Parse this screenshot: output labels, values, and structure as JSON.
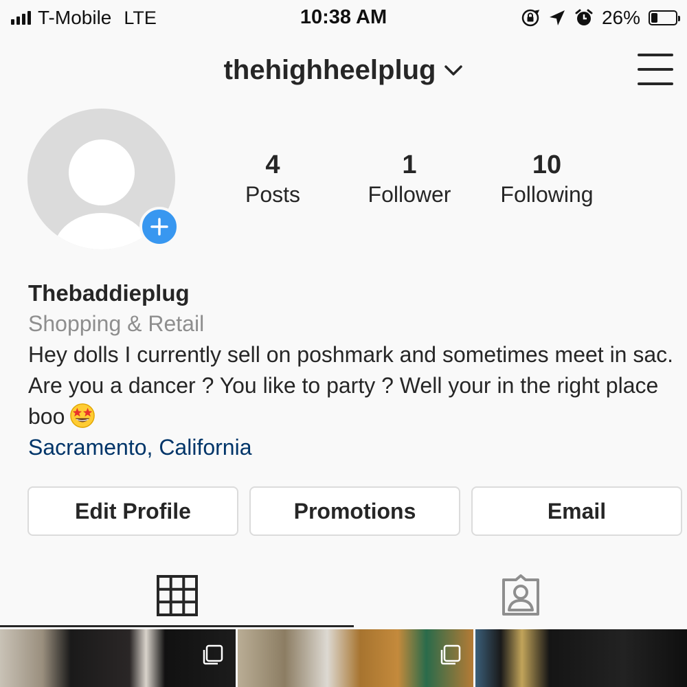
{
  "status_bar": {
    "carrier": "T-Mobile",
    "network": "LTE",
    "time": "10:38 AM",
    "battery": "26%",
    "battery_level": 0.26,
    "icons": [
      "signal-icon",
      "screen-rotation-lock-icon",
      "location-arrow-icon",
      "alarm-icon",
      "battery-icon"
    ]
  },
  "header": {
    "username": "thehighheelplug",
    "icons": [
      "chevron-down-icon",
      "hamburger-menu-icon"
    ]
  },
  "profile": {
    "avatar_icon": "default-avatar-icon",
    "add_icon": "add-story-icon",
    "stats": [
      {
        "count": "4",
        "label": "Posts"
      },
      {
        "count": "1",
        "label": "Follower"
      },
      {
        "count": "10",
        "label": "Following"
      }
    ]
  },
  "bio": {
    "name": "Thebaddieplug",
    "category": "Shopping & Retail",
    "text": "Hey dolls I currently sell on poshmark and sometimes meet in sac. Are you a dancer ? You like to party ? Well your in the right place boo",
    "emoji": "star-struck-emoji-icon",
    "location": "Sacramento, California"
  },
  "buttons": {
    "edit_profile": "Edit Profile",
    "promotions": "Promotions",
    "email": "Email"
  },
  "tabs": {
    "icons": [
      "grid-icon",
      "tagged-photos-icon"
    ],
    "active": "grid"
  },
  "colors": {
    "background": "#f9f9f9",
    "text": "#262626",
    "secondary_text": "#8e8e8e",
    "link": "#003569",
    "accent": "#3897f0",
    "border": "#dbdbdb"
  }
}
